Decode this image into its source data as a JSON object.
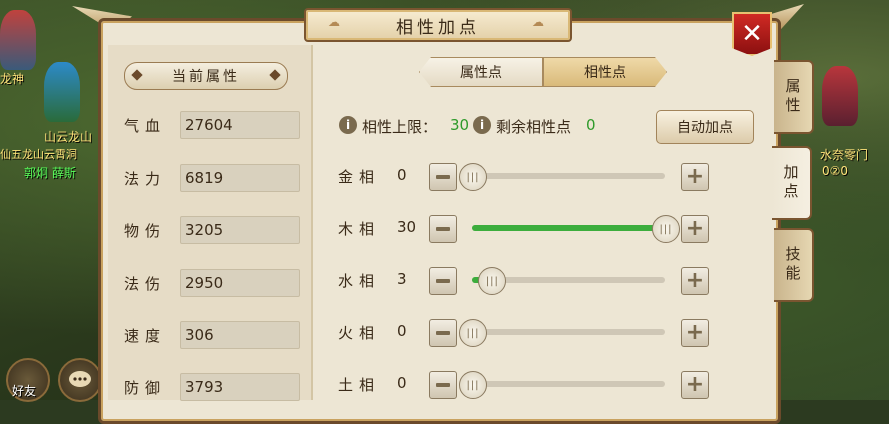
{
  "window": {
    "title": "相性加点",
    "close_symbol": "✕"
  },
  "background": {
    "labels": [
      {
        "text": "龙神",
        "color": "#ffe37a"
      },
      {
        "text": "山云龙山",
        "color": "#ffe37a"
      },
      {
        "text": "仙五龙山云霄洞",
        "color": "#ffe37a"
      },
      {
        "text": "郭炯 薛斯",
        "color": "#5aff5a"
      },
      {
        "text": "水奈零门",
        "color": "#ffe37a"
      },
      {
        "text": "0②0",
        "color": "#ffe37a"
      },
      {
        "text": "好友",
        "color": "#ffffff"
      }
    ]
  },
  "current_attributes": {
    "header": "当前属性",
    "rows": [
      {
        "name": "气血",
        "value": "27604"
      },
      {
        "name": "法力",
        "value": "6819"
      },
      {
        "name": "物伤",
        "value": "3205"
      },
      {
        "name": "法伤",
        "value": "2950"
      },
      {
        "name": "速度",
        "value": "306"
      },
      {
        "name": "防御",
        "value": "3793"
      }
    ]
  },
  "tabs": [
    {
      "label": "属性点",
      "active": false
    },
    {
      "label": "相性点",
      "active": true
    }
  ],
  "affinity": {
    "limit_label": "相性上限：",
    "limit_value": "30",
    "remaining_label": "剩余相性点",
    "remaining_value": "0",
    "auto_button": "自动加点",
    "info_icon": "i",
    "max": 30,
    "rows": [
      {
        "name": "金相",
        "value": "0",
        "level": 0
      },
      {
        "name": "木相",
        "value": "30",
        "level": 30
      },
      {
        "name": "水相",
        "value": "3",
        "level": 3
      },
      {
        "name": "火相",
        "value": "0",
        "level": 0
      },
      {
        "name": "土相",
        "value": "0",
        "level": 0
      }
    ]
  },
  "side_tabs": [
    {
      "label": "属性",
      "active": false
    },
    {
      "label": "加点",
      "active": true
    },
    {
      "label": "技能",
      "active": false
    }
  ],
  "colors": {
    "accent_green": "#2e9a2a",
    "slider_fill": "#3cad3c",
    "close_red": "#c8221c",
    "panel_bg": "#ede6d4"
  }
}
